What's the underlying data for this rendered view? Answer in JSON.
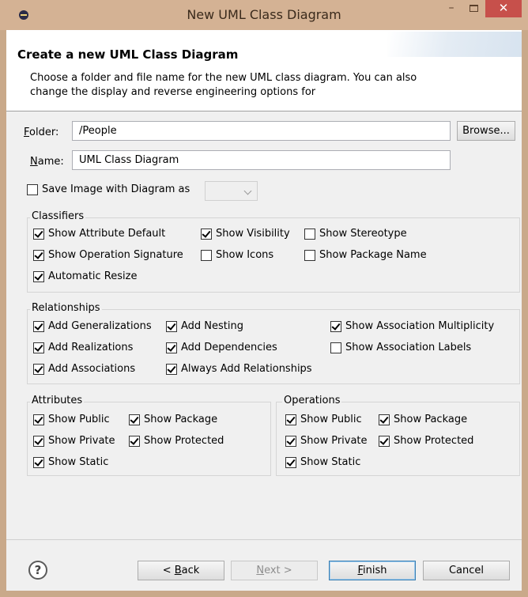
{
  "window": {
    "title": "New UML Class Diagram",
    "close_glyph": "✕",
    "min_glyph": "–"
  },
  "header": {
    "title": "Create a new UML Class Diagram",
    "description": "Choose a folder and file name for the new UML class diagram. You can also change the display and reverse engineering options for"
  },
  "form": {
    "folder_label_u": "F",
    "folder_label_rest": "older:",
    "folder_value": "/People",
    "browse_label": "Browse...",
    "name_label_u": "N",
    "name_label_rest": "ame:",
    "name_value": "UML Class Diagram",
    "save_image_label": "Save Image with Diagram as"
  },
  "classifiers": {
    "title": "Classifiers",
    "items": [
      {
        "label": "Show Attribute Default",
        "checked": true
      },
      {
        "label": "Show Visibility",
        "checked": true
      },
      {
        "label": "Show Stereotype",
        "checked": false
      },
      {
        "label": "Show Operation Signature",
        "checked": true
      },
      {
        "label": "Show Icons",
        "checked": false
      },
      {
        "label": "Show Package Name",
        "checked": false
      },
      {
        "label": "Automatic Resize",
        "checked": true
      }
    ]
  },
  "relationships": {
    "title": "Relationships",
    "items": [
      {
        "label": "Add Generalizations",
        "checked": true
      },
      {
        "label": "Add Nesting",
        "checked": true
      },
      {
        "label": "Show Association Multiplicity",
        "checked": true
      },
      {
        "label": "Add Realizations",
        "checked": true
      },
      {
        "label": "Add Dependencies",
        "checked": true
      },
      {
        "label": "Show Association Labels",
        "checked": false
      },
      {
        "label": "Add Associations",
        "checked": true
      },
      {
        "label": "Always Add Relationships",
        "checked": true
      }
    ]
  },
  "attributes": {
    "title": "Attributes",
    "items": [
      {
        "label": "Show Public",
        "checked": true
      },
      {
        "label": "Show Package",
        "checked": true
      },
      {
        "label": "Show Private",
        "checked": true
      },
      {
        "label": "Show Protected",
        "checked": true
      },
      {
        "label": "Show Static",
        "checked": true
      }
    ]
  },
  "operations": {
    "title": "Operations",
    "items": [
      {
        "label": "Show Public",
        "checked": true
      },
      {
        "label": "Show Package",
        "checked": true
      },
      {
        "label": "Show Private",
        "checked": true
      },
      {
        "label": "Show Protected",
        "checked": true
      },
      {
        "label": "Show Static",
        "checked": true
      }
    ]
  },
  "footer": {
    "help_glyph": "?",
    "back_prefix": "< ",
    "back_u": "B",
    "back_rest": "ack",
    "next_u": "N",
    "next_rest": "ext >",
    "finish_u": "F",
    "finish_rest": "inish",
    "cancel_label": "Cancel"
  }
}
